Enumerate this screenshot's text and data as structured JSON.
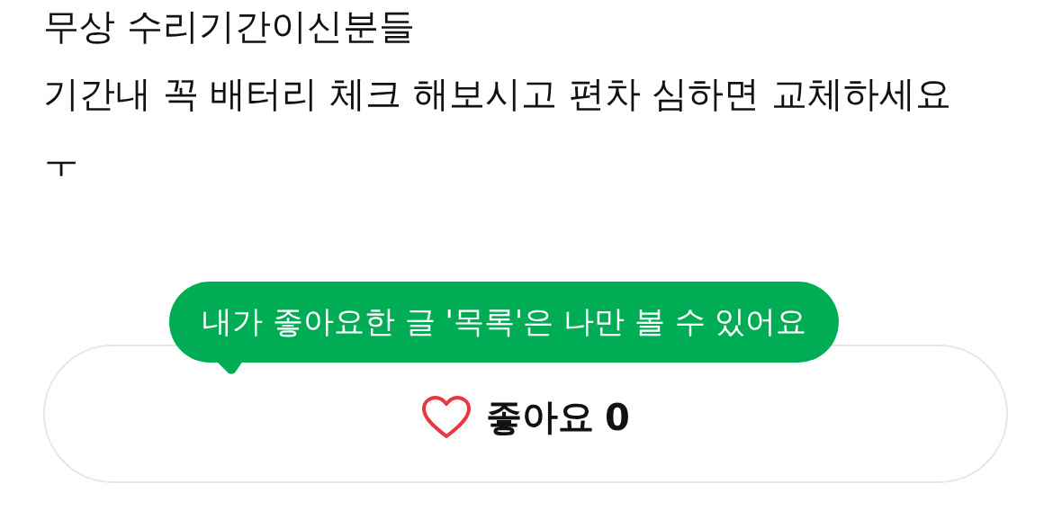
{
  "post": {
    "lines": [
      "무상 수리기간이신분들",
      "기간내 꼭 배터리 체크 해보시고 편차 심하면 교체하세요",
      "ㅜ"
    ]
  },
  "tooltip": {
    "text": "내가 좋아요한 글 '목록'은 나만 볼 수 있어요"
  },
  "like_button": {
    "label": "좋아요",
    "count": "0",
    "liked": false
  }
}
